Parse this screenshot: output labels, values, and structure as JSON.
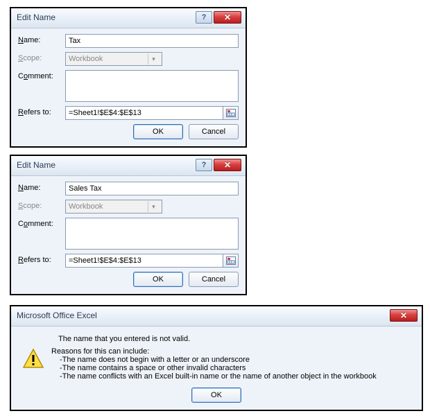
{
  "dialog1": {
    "title": "Edit Name",
    "name_label_pre": "N",
    "name_label_post": "ame:",
    "name_value": "Tax",
    "scope_label_pre": "S",
    "scope_label_post": "cope:",
    "scope_value": "Workbook",
    "comment_label_pre": "C",
    "comment_label_mid": "o",
    "comment_label_post": "mment:",
    "comment_value": "",
    "refers_label_pre": "R",
    "refers_label_post": "efers to:",
    "refers_value": "=Sheet1!$E$4:$E$13",
    "ok": "OK",
    "cancel": "Cancel"
  },
  "dialog2": {
    "title": "Edit Name",
    "name_value": "Sales Tax",
    "scope_value": "Workbook",
    "comment_value": "",
    "refers_value": "=Sheet1!$E$4:$E$13",
    "ok": "OK",
    "cancel": "Cancel"
  },
  "msg": {
    "title": "Microsoft Office Excel",
    "line1": "The name that you entered is not valid.",
    "reasons_header": "Reasons for this can include:",
    "r1": "-The name does not begin with a letter or an underscore",
    "r2": "-The name contains a space or other invalid characters",
    "r3": "-The name conflicts with an Excel built-in name or the name of another object in the workbook",
    "ok": "OK"
  },
  "icons": {
    "help": "?",
    "close": "✕",
    "chevron": "▾"
  }
}
